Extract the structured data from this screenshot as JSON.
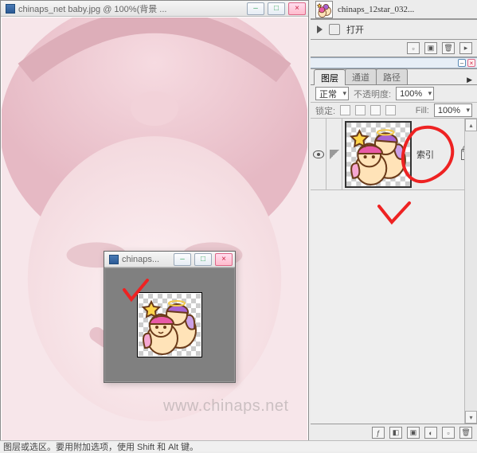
{
  "main_doc": {
    "title": "chinaps_net baby.jpg @ 100%(背景 ..."
  },
  "sub_doc": {
    "title": "chinaps..."
  },
  "right": {
    "filetab": {
      "name": "chinaps_12star_032..."
    },
    "actions": {
      "open_label": "打开"
    },
    "layers_panel": {
      "tabs": [
        "图层",
        "通道",
        "路径"
      ],
      "blend_mode": "正常",
      "opacity_label": "不透明度:",
      "opacity_value": "100%",
      "lock_label": "锁定:",
      "fill_label": "Fill:",
      "fill_value": "100%",
      "layer_name": "索引"
    }
  },
  "watermark": "www.chinaps.net",
  "status": "图层或选区。要用附加选项，使用 Shift 和 Alt 键。"
}
